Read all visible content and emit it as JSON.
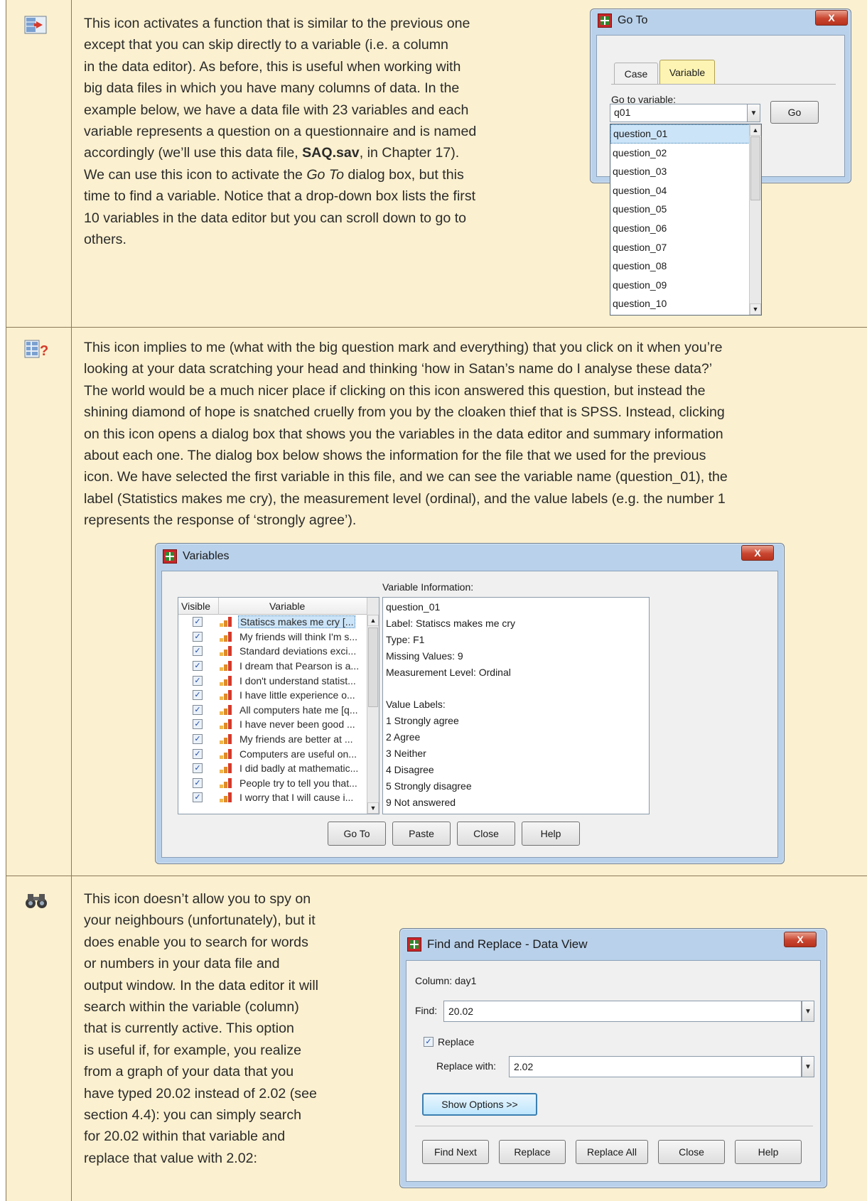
{
  "rows": [
    {
      "icon": "go-to-variable-icon",
      "text": {
        "l1": "This icon activates a function that is similar to the previous one",
        "l2": "except that you can skip directly to a variable (i.e. a column",
        "l3": "in the data editor). As before, this is useful when working with",
        "l4": "big data files in which you have many columns of data. In the",
        "l5": "example below, we have a data file with 23 variables and each",
        "l6": "variable represents a question on a questionnaire and is named",
        "l7a": "accordingly (we’ll use this data file, ",
        "l7b": "SAQ.sav",
        "l7c": ", in Chapter 17).",
        "l8a": "We can use this icon to activate the ",
        "l8b": "Go To",
        "l8c": " dialog box, but this",
        "l9": "time to find a variable. Notice that a drop-down box lists the first",
        "l10": "10 variables in the data editor but you can scroll down to go to",
        "l11": "others."
      }
    },
    {
      "icon": "variables-icon",
      "text": {
        "l1": "This icon implies to me (what with the big question mark and everything) that you click on it when you’re",
        "l2": "looking at your data scratching your head and thinking ‘how in Satan’s name do I analyse these data?’",
        "l3": "The world would be a much nicer place if clicking on this icon answered this question, but instead the",
        "l4": "shining diamond of hope is snatched cruelly from you by the cloaken thief that is SPSS. Instead, clicking",
        "l5": "on this icon opens a dialog box that shows you the variables in the data editor and summary information",
        "l6": "about each one. The dialog box below shows the information for the file that we used for the previous",
        "l7": "icon. We have selected the first variable in this file, and we can see the variable name (question_01), the",
        "l8": "label (Statistics makes me cry), the measurement level (ordinal), and the value labels (e.g. the number 1",
        "l9": "represents the response of ‘strongly agree’)."
      }
    },
    {
      "icon": "binoculars-icon",
      "text": {
        "l1": "This icon doesn’t allow you to spy on",
        "l2": "your neighbours (unfortunately), but it",
        "l3": "does enable you to search for words",
        "l4": "or numbers in your data file and",
        "l5": "output window. In the data editor it will",
        "l6": "search within the variable (column)",
        "l7": "that is currently active. This option",
        "l8": "is useful if, for example, you realize",
        "l9": "from a graph of your data that you",
        "l10": "have typed 20.02 instead of 2.02 (see",
        "l11": "section 4.4): you can simply search",
        "l12": "for 20.02 within that variable and",
        "l13": "replace that value with 2.02:"
      }
    }
  ],
  "goto_dialog": {
    "title": "Go To",
    "close": "X",
    "tabs": [
      "Case",
      "Variable"
    ],
    "field_label": "Go to variable:",
    "value": "q01",
    "go_button": "Go",
    "options": [
      "question_01",
      "question_02",
      "question_03",
      "question_04",
      "question_05",
      "question_06",
      "question_07",
      "question_08",
      "question_09",
      "question_10"
    ]
  },
  "variables_dialog": {
    "title": "Variables",
    "close": "X",
    "info_label": "Variable Information:",
    "col_visible": "Visible",
    "col_variable": "Variable",
    "check": "✓",
    "variables": [
      "Statiscs makes me cry [...",
      "My friends will think I'm s...",
      "Standard deviations exci...",
      "I dream that Pearson is a...",
      "I don't understand statist...",
      "I have little experience o...",
      "All computers hate me [q...",
      "I have never been good ...",
      "My friends are better at ...",
      "Computers are useful on...",
      "I did badly at mathematic...",
      "People try to tell you that...",
      "I worry that I will cause i..."
    ],
    "info_lines": [
      "question_01",
      "Label:  Statiscs makes me cry",
      "Type:  F1",
      "Missing Values:  9",
      "Measurement Level:  Ordinal",
      "",
      "Value Labels:",
      "1 Strongly agree",
      "2 Agree",
      "3 Neither",
      "4 Disagree",
      "5 Strongly disagree",
      "9 Not answered"
    ],
    "buttons": [
      "Go To",
      "Paste",
      "Close",
      "Help"
    ]
  },
  "find_dialog": {
    "title": "Find and Replace - Data View",
    "close": "X",
    "column_label": "Column:  day1",
    "find_label": "Find:",
    "find_value": "20.02",
    "replace_checkbox_label": "Replace",
    "replace_with_label": "Replace with:",
    "replace_value": "2.02",
    "show_options": "Show Options >>",
    "buttons": [
      "Find Next",
      "Replace",
      "Replace All",
      "Close",
      "Help"
    ]
  }
}
